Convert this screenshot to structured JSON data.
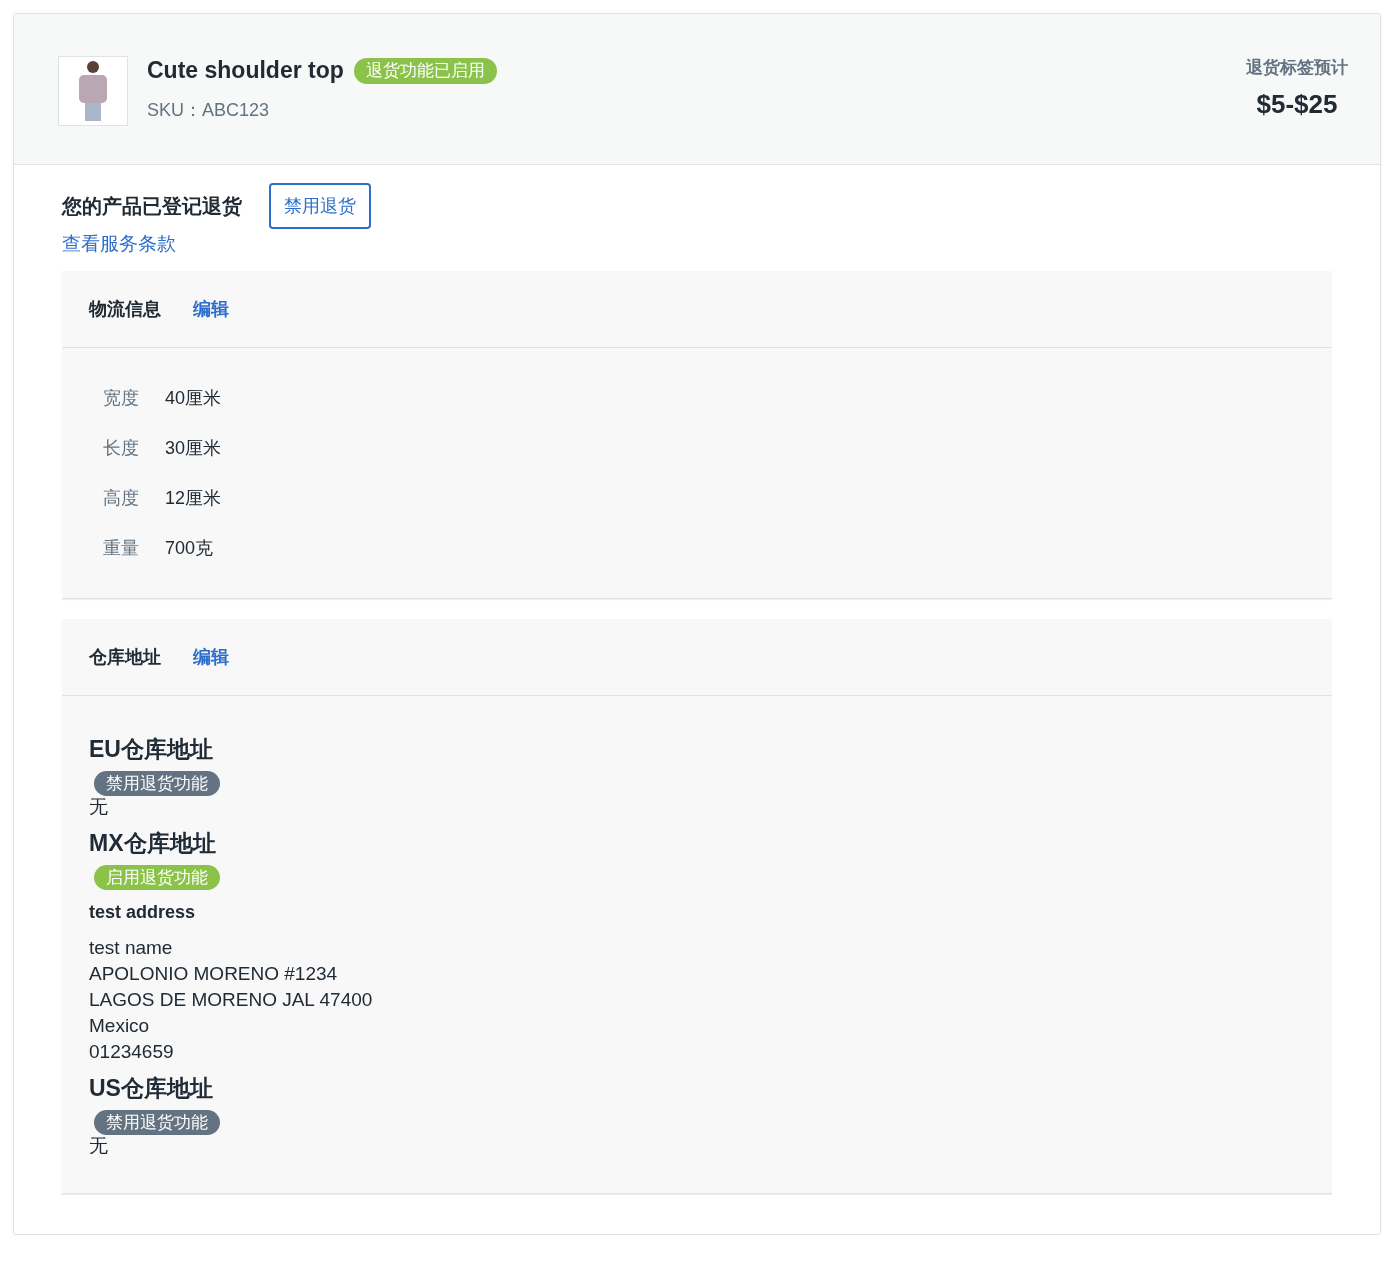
{
  "product": {
    "name": "Cute shoulder top",
    "status_badge": "退货功能已启用",
    "sku": "SKU：ABC123",
    "estimate_label": "退货标签预计",
    "estimate_value": "$5-$25"
  },
  "registration": {
    "title": "您的产品已登记退货",
    "disable_button": "禁用退货",
    "terms_link": "查看服务条款"
  },
  "logistics": {
    "title": "物流信息",
    "edit_link": "编辑",
    "fields": [
      {
        "label": "宽度",
        "value": "40厘米"
      },
      {
        "label": "长度",
        "value": "30厘米"
      },
      {
        "label": "高度",
        "value": "12厘米"
      },
      {
        "label": "重量",
        "value": "700克"
      }
    ]
  },
  "warehouses": {
    "title": "仓库地址",
    "edit_link": "编辑",
    "items": [
      {
        "title": "EU仓库地址",
        "badge": "禁用退货功能",
        "enabled": false,
        "none_text": "无"
      },
      {
        "title": "MX仓库地址",
        "badge": "启用退货功能",
        "enabled": true,
        "address_name": "test address",
        "address_lines": [
          "test name",
          "APOLONIO MORENO #1234",
          "LAGOS DE MORENO JAL 47400",
          "Mexico",
          "01234659"
        ]
      },
      {
        "title": "US仓库地址",
        "badge": "禁用退货功能",
        "enabled": false,
        "none_text": "无"
      }
    ]
  }
}
